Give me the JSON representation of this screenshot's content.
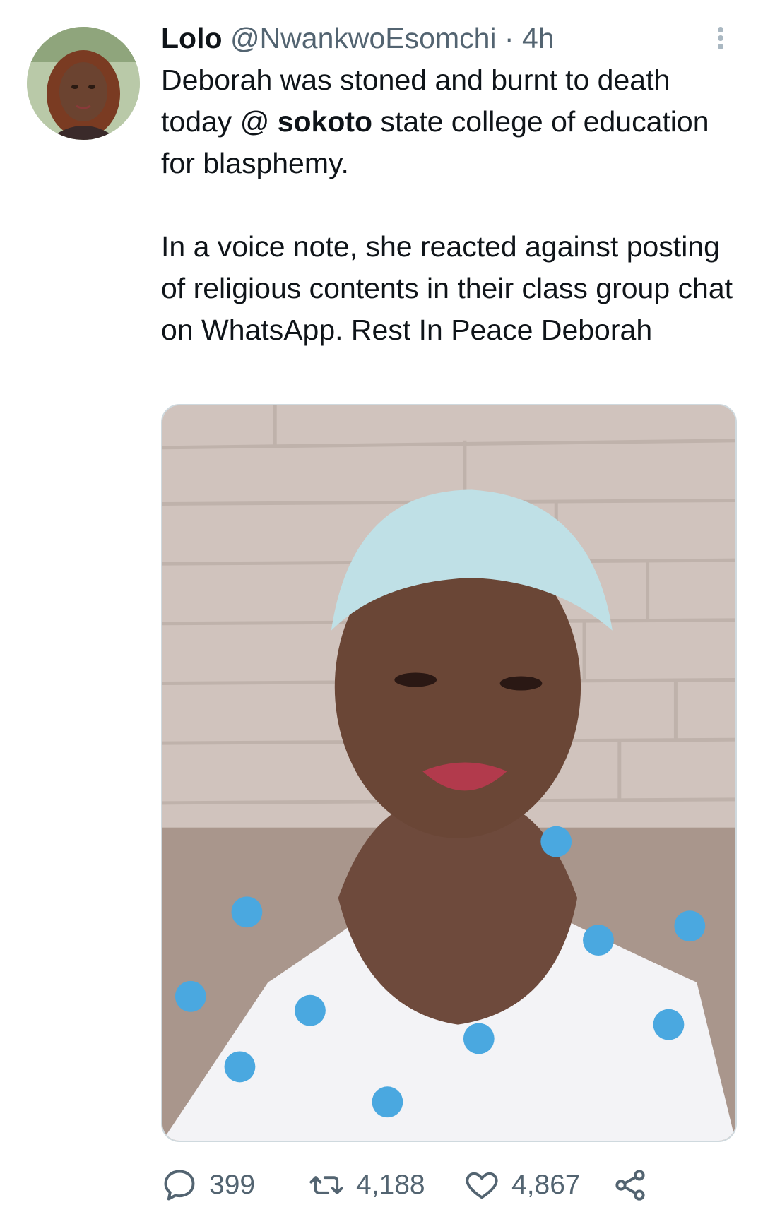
{
  "tweet": {
    "author": {
      "display_name": "Lolo",
      "handle": "@NwankwoEsomchi",
      "separator": "·",
      "timestamp": "4h"
    },
    "text": {
      "line_a_pre": "Deborah was stoned and burnt to death today @ ",
      "mention": "sokoto",
      "line_a_post": " state college of education for blasphemy.",
      "paragraph_2": "In a voice note, she reacted against posting of religious contents in their class group chat on WhatsApp.  Rest In Peace Deborah"
    },
    "actions": {
      "replies": "399",
      "retweets": "4,188",
      "likes": "4,867"
    }
  },
  "icons": {
    "more": "more-vertical-icon",
    "reply": "reply-icon",
    "retweet": "retweet-icon",
    "like": "heart-icon",
    "share": "share-icon"
  },
  "colors": {
    "text_primary": "#0f1419",
    "text_secondary": "#536471",
    "border": "#cfd9de"
  }
}
